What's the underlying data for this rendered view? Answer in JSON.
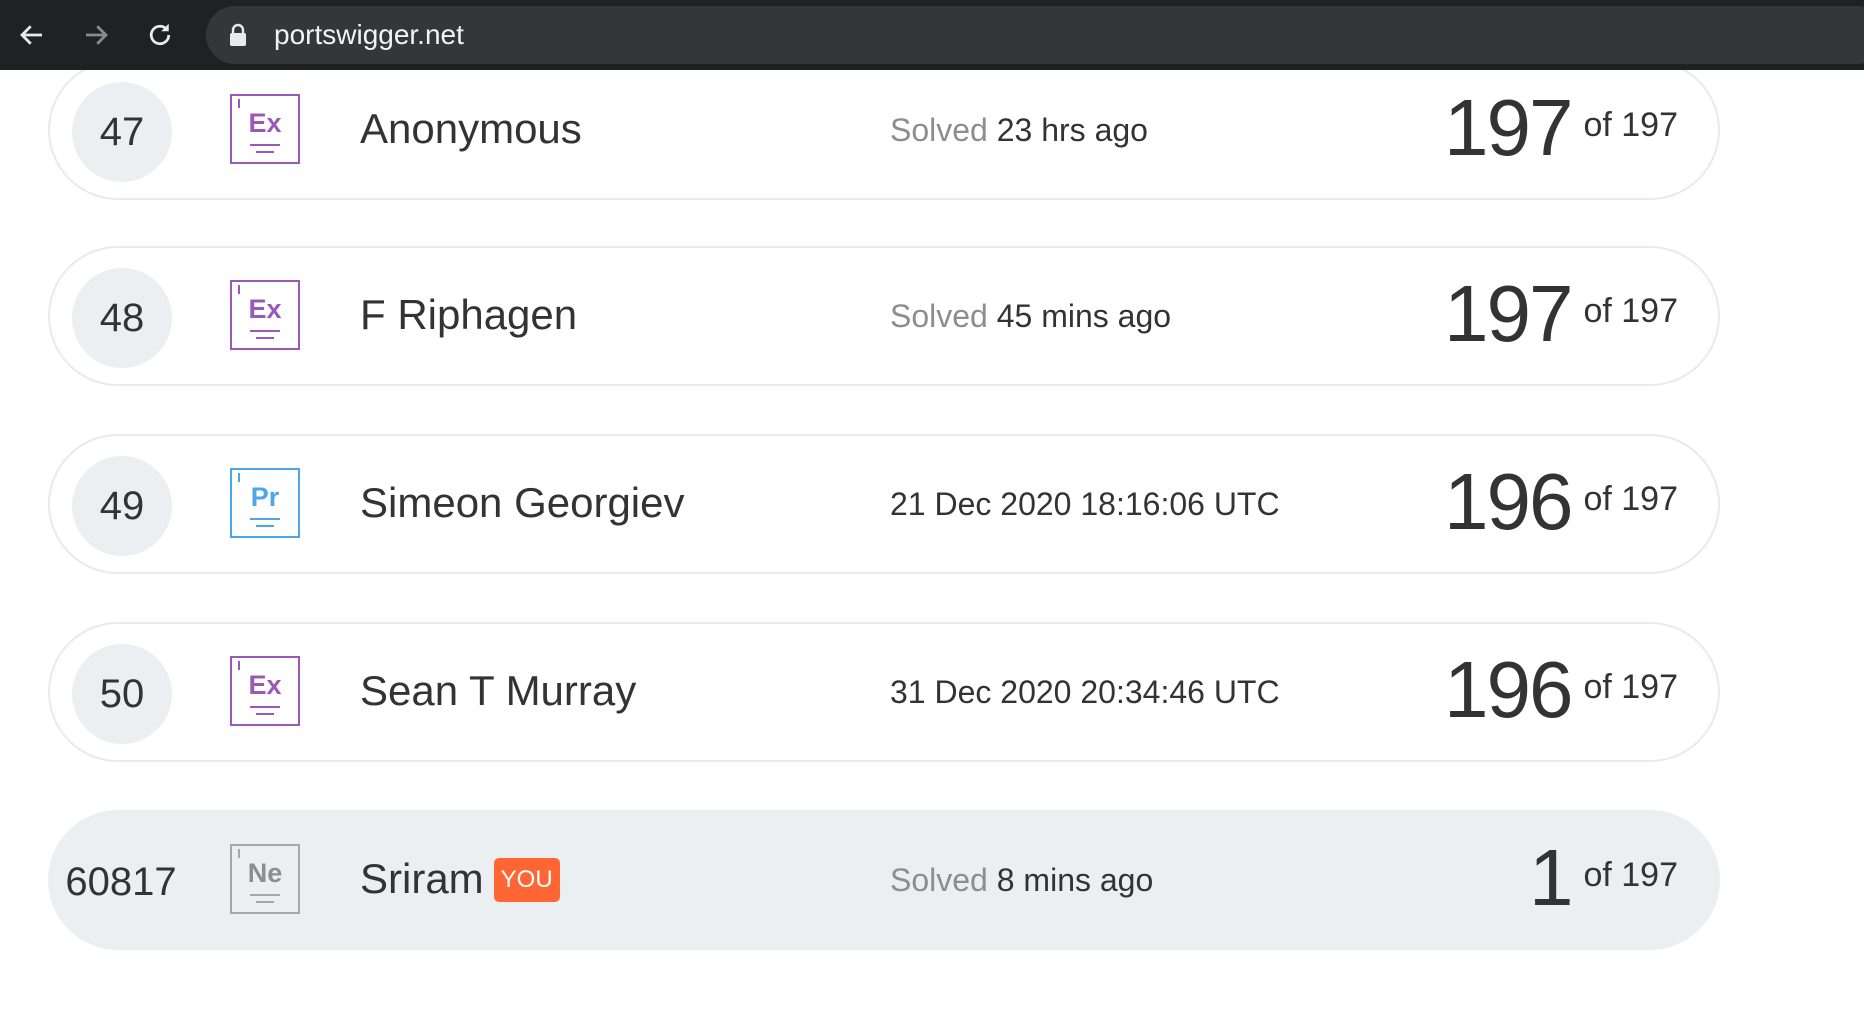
{
  "browser": {
    "url": "portswigger.net"
  },
  "colors": {
    "toolbar_bg": "#202124",
    "expert": "#9b59b6",
    "practitioner": "#4aa8e8",
    "newcomer": "#a6a6a6",
    "you_tag": "#ff6633"
  },
  "leaderboard": {
    "rows": [
      {
        "rank": "47",
        "level": "Ex",
        "level_icon": "expert-level-icon",
        "name": "Anonymous",
        "status_prefix": "Solved",
        "status": "23 hrs ago",
        "solved": "197",
        "of_total": "of 197",
        "is_you": false
      },
      {
        "rank": "48",
        "level": "Ex",
        "level_icon": "expert-level-icon",
        "name": "F Riphagen",
        "status_prefix": "Solved",
        "status": "45 mins ago",
        "solved": "197",
        "of_total": "of 197",
        "is_you": false
      },
      {
        "rank": "49",
        "level": "Pr",
        "level_icon": "practitioner-level-icon",
        "name": "Simeon Georgiev",
        "status_prefix": "",
        "status": "21 Dec 2020 18:16:06 UTC",
        "solved": "196",
        "of_total": "of 197",
        "is_you": false
      },
      {
        "rank": "50",
        "level": "Ex",
        "level_icon": "expert-level-icon",
        "name": "Sean T Murray",
        "status_prefix": "",
        "status": "31 Dec 2020 20:34:46 UTC",
        "solved": "196",
        "of_total": "of 197",
        "is_you": false
      },
      {
        "rank": "60817",
        "level": "Ne",
        "level_icon": "newcomer-level-icon",
        "name": "Sriram",
        "you_label": "YOU",
        "status_prefix": "Solved",
        "status": "8 mins ago",
        "solved": "1",
        "of_total": "of 197",
        "is_you": true
      }
    ]
  }
}
